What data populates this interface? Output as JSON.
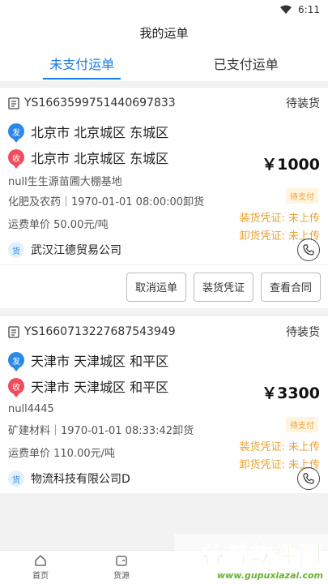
{
  "status_bar": {
    "time": "6:11",
    "icons": [
      "wifi-icon",
      "battery-icon"
    ]
  },
  "header": {
    "title": "我的运单"
  },
  "tabs": [
    {
      "label": "未支付运单",
      "active": true
    },
    {
      "label": "已支付运单",
      "active": false
    }
  ],
  "orders": [
    {
      "order_no": "YS1663599751440697833",
      "state": "待装货",
      "from_label": "发",
      "from": "北京市 北京城区 东城区",
      "to_label": "收",
      "to": "北京市 北京城区 东城区",
      "price": "￥1000",
      "pay_status": "待支付",
      "place": "null生生源苗圃大棚基地",
      "goods_time": "化肥及农药｜1970-01-01 08:00:00卸货",
      "load_cert": "装货凭证: 未上传",
      "unload_cert": "卸货凭证: 未上传",
      "unit_price": "运费单价 50.00元/吨",
      "company_label": "货",
      "company": "武汉江德贸易公司",
      "actions": [
        "取消运单",
        "装货凭证",
        "查看合同"
      ]
    },
    {
      "order_no": "YS1660713227687543949",
      "state": "待装货",
      "from_label": "发",
      "from": "天津市 天津城区 和平区",
      "to_label": "收",
      "to": "天津市 天津城区 和平区",
      "price": "￥3300",
      "pay_status": "待支付",
      "place": "null4445",
      "goods_time": "矿建材料｜1970-01-01 08:33:42卸货",
      "load_cert": "装货凭证: 未上传",
      "unload_cert": "卸货凭证: 未上传",
      "unit_price": "运费单价 110.00元/吨",
      "company_label": "货",
      "company": "物流科技有限公司D",
      "actions": []
    }
  ],
  "bottom_nav": [
    {
      "label": "首页",
      "icon": "home-icon"
    },
    {
      "label": "货源",
      "icon": "wallet-icon"
    }
  ],
  "watermark": {
    "line1": "谷普软件园",
    "line2": "www.gupuxiazai.com"
  },
  "colors": {
    "accent": "#1a7ae6",
    "send": "#2b88e8",
    "receive": "#ef4d5e",
    "warning": "#e8a334"
  }
}
